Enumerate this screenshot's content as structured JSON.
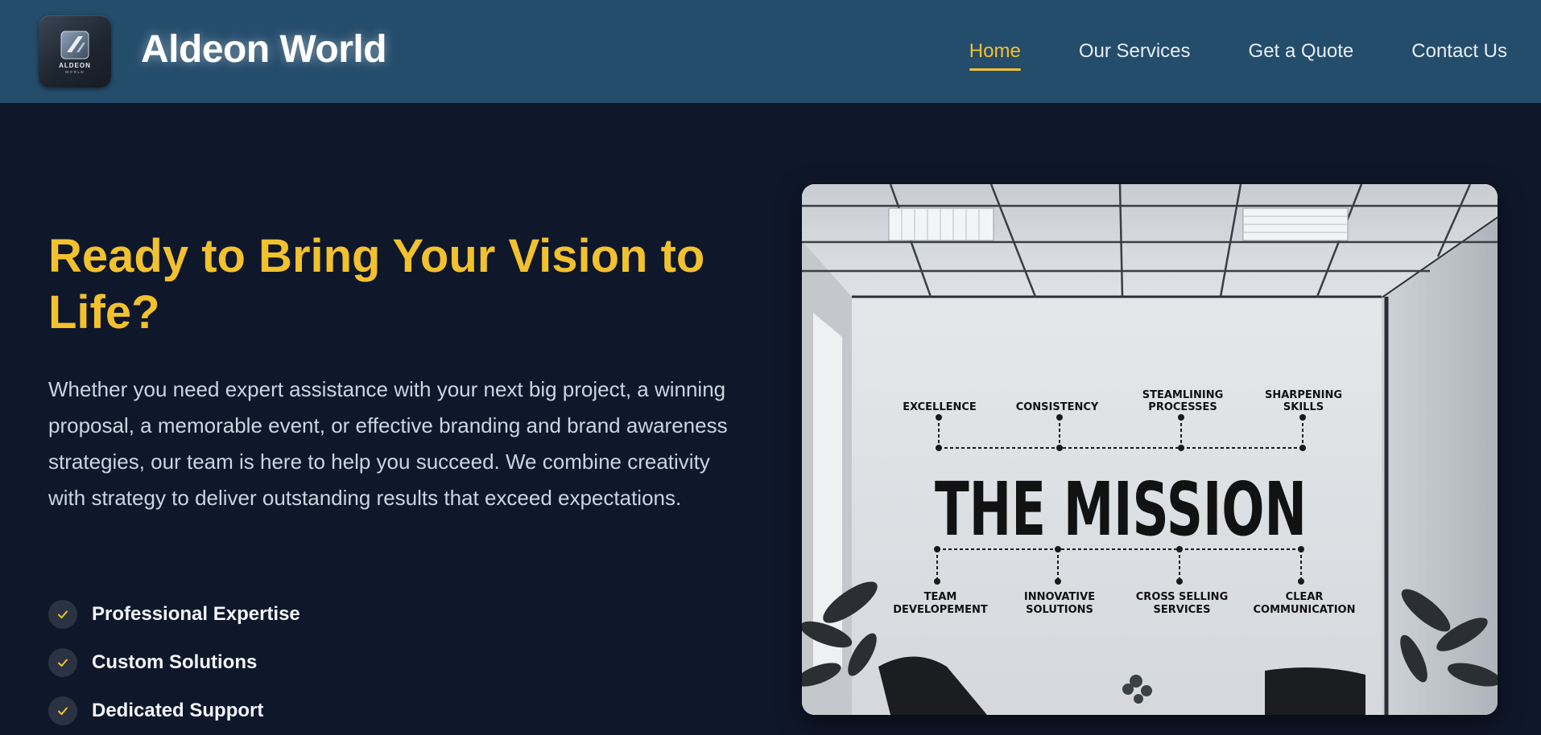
{
  "header": {
    "brand": "Aldeon World",
    "logo": {
      "word": "ALDEON",
      "sub": "WORLD"
    },
    "nav": [
      {
        "label": "Home",
        "active": true
      },
      {
        "label": "Our Services",
        "active": false
      },
      {
        "label": "Get a Quote",
        "active": false
      },
      {
        "label": "Contact Us",
        "active": false
      }
    ]
  },
  "hero": {
    "title": "Ready to Bring Your Vision to Life?",
    "text": "Whether you need expert assistance with your next big project, a winning proposal, a memorable event, or effective branding and brand awareness strategies, our team is here to help you succeed. We combine creativity with strategy to deliver outstanding results that exceed expectations.",
    "features": [
      {
        "label": "Professional Expertise",
        "icon": "check-icon"
      },
      {
        "label": "Custom Solutions",
        "icon": "check-icon"
      },
      {
        "label": "Dedicated Support",
        "icon": "check-icon"
      }
    ]
  },
  "image": {
    "mission_title": "THE MISSION",
    "top_labels": [
      [
        "EXCELLENCE"
      ],
      [
        "CONSISTENCY"
      ],
      [
        "STEAMLINING",
        "PROCESSES"
      ],
      [
        "SHARPENING",
        "SKILLS"
      ]
    ],
    "bottom_labels": [
      [
        "TEAM",
        "DEVELOPEMENT"
      ],
      [
        "INNOVATIVE",
        "SOLUTIONS"
      ],
      [
        "CROSS SELLING",
        "SERVICES"
      ],
      [
        "CLEAR",
        "COMMUNICATION"
      ]
    ]
  },
  "colors": {
    "header_bg": "#244c6b",
    "page_bg": "#0f172a",
    "accent": "#f2c12e"
  }
}
